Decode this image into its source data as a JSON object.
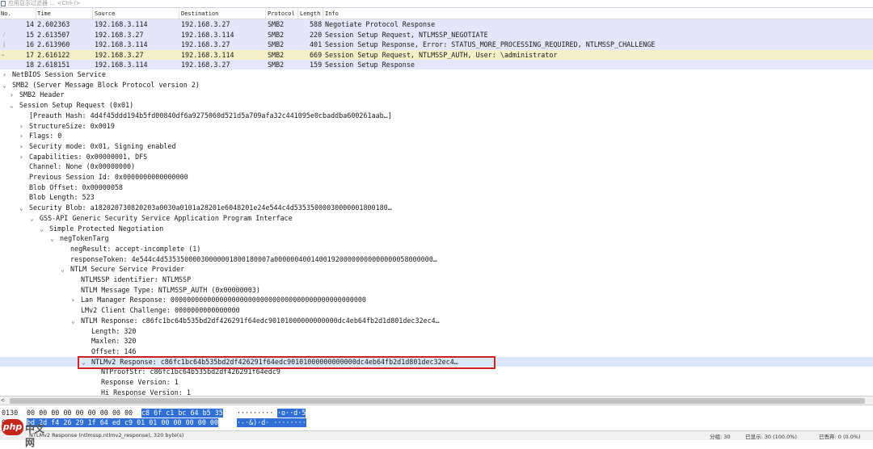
{
  "filter": {
    "placeholder": "应用显示过滤器 … <Ctrl-/>"
  },
  "columns": [
    "No.",
    "Time",
    "Source",
    "Destination",
    "Protocol",
    "Length",
    "Info"
  ],
  "packets": [
    {
      "no": "14",
      "time": "2.602363",
      "src": "192.168.3.114",
      "dst": "192.168.3.27",
      "proto": "SMB2",
      "len": "588",
      "info": "Negotiate Protocol Response"
    },
    {
      "no": "15",
      "time": "2.613507",
      "src": "192.168.3.27",
      "dst": "192.168.3.114",
      "proto": "SMB2",
      "len": "220",
      "info": "Session Setup Request, NTLMSSP_NEGOTIATE"
    },
    {
      "no": "16",
      "time": "2.613960",
      "src": "192.168.3.114",
      "dst": "192.168.3.27",
      "proto": "SMB2",
      "len": "401",
      "info": "Session Setup Response, Error: STATUS_MORE_PROCESSING_REQUIRED, NTLMSSP_CHALLENGE"
    },
    {
      "no": "17",
      "time": "2.616122",
      "src": "192.168.3.27",
      "dst": "192.168.3.114",
      "proto": "SMB2",
      "len": "669",
      "info": "Session Setup Request, NTLMSSP_AUTH, User: \\administrator"
    },
    {
      "no": "18",
      "time": "2.618151",
      "src": "192.168.3.114",
      "dst": "192.168.3.27",
      "proto": "SMB2",
      "len": "159",
      "info": "Session Setup Response"
    }
  ],
  "tree": [
    {
      "arrow": ">",
      "text": "NetBIOS Session Service"
    },
    {
      "arrow": "v",
      "text": "SMB2 (Server Message Block Protocol version 2)"
    },
    {
      "arrow": ">",
      "text": "SMB2 Header"
    },
    {
      "arrow": "v",
      "text": "Session Setup Request (0x01)"
    },
    {
      "arrow": "",
      "text": "[Preauth Hash: 4d4f45ddd194b5fd00840df6a9275060d521d5a709afa32c441095e0cbaddba600261aab…]"
    },
    {
      "arrow": ">",
      "text": "StructureSize: 0x0019"
    },
    {
      "arrow": ">",
      "text": "Flags: 0"
    },
    {
      "arrow": ">",
      "text": "Security mode: 0x01, Signing enabled"
    },
    {
      "arrow": ">",
      "text": "Capabilities: 0x00000001, DFS"
    },
    {
      "arrow": "",
      "text": "Channel: None (0x00000000)"
    },
    {
      "arrow": "",
      "text": "Previous Session Id: 0x0000000000000000"
    },
    {
      "arrow": "",
      "text": "Blob Offset: 0x00000058"
    },
    {
      "arrow": "",
      "text": "Blob Length: 523"
    },
    {
      "arrow": "v",
      "text": "Security Blob: a182020730820203a0030a0101a28201e6048201e24e544c4d53535000030000001800180…"
    },
    {
      "arrow": "v",
      "text": "GSS-API Generic Security Service Application Program Interface"
    },
    {
      "arrow": "v",
      "text": "Simple Protected Negotiation"
    },
    {
      "arrow": "v",
      "text": "negTokenTarg"
    },
    {
      "arrow": "",
      "text": "negResult: accept-incomplete (1)"
    },
    {
      "arrow": "",
      "text": "responseToken: 4e544c4d53535000030000001800180007a000000400140019200000000000000058000000…"
    },
    {
      "arrow": "v",
      "text": "NTLM Secure Service Provider"
    },
    {
      "arrow": "",
      "text": "NTLMSSP identifier: NTLMSSP"
    },
    {
      "arrow": "",
      "text": "NTLM Message Type: NTLMSSP_AUTH (0x00000003)"
    },
    {
      "arrow": ">",
      "text": "Lan Manager Response: 000000000000000000000000000000000000000000000000"
    },
    {
      "arrow": "",
      "text": "LMv2 Client Challenge: 0000000000000000"
    },
    {
      "arrow": "v",
      "text": "NTLM Response: c86fc1bc64b535bd2df426291f64edc90101000000000000dc4eb64fb2d1d801dec32ec4…"
    },
    {
      "arrow": "",
      "text": "Length: 320"
    },
    {
      "arrow": "",
      "text": "Maxlen: 320"
    },
    {
      "arrow": "",
      "text": "Offset: 146"
    },
    {
      "arrow": "v",
      "text": "NTLMv2 Response: c86fc1bc64b535bd2df426291f64edc90101000000000000dc4eb64fb2d1d801dec32ec4…"
    },
    {
      "arrow": "",
      "text": "NTProofStr: c86fc1bc64b535bd2df426291f64edc9"
    },
    {
      "arrow": "",
      "text": "Response Version: 1"
    },
    {
      "arrow": "",
      "text": "Hi Response Version: 1"
    }
  ],
  "bytes": [
    {
      "offset": "0130",
      "hex_plain": "00 00 00 00 00 00 00 00  00 ",
      "hex_hl": "c8 6f c1 bc 64 b5 35",
      "ascii_plain": "·········",
      "ascii_hl": "·o··d·5"
    },
    {
      "offset": "0140",
      "hex_plain": "",
      "hex_hl": "bd 2d f4 26 29 1f 64 ed  c9 01 01 00 00 00 00 00",
      "ascii_plain": "",
      "ascii_hl": "·-·&)·d· ········"
    }
  ],
  "status": {
    "left": "NTLMv2 Response (ntlmssp.ntlmv2_response), 320 byte(s)",
    "groups": "分组: 30",
    "shown": "已显示: 30 (100.0%)",
    "dropped": "已丢弃: 0 (0.0%)"
  },
  "watermark": {
    "logo": "php",
    "text": "中文网"
  }
}
